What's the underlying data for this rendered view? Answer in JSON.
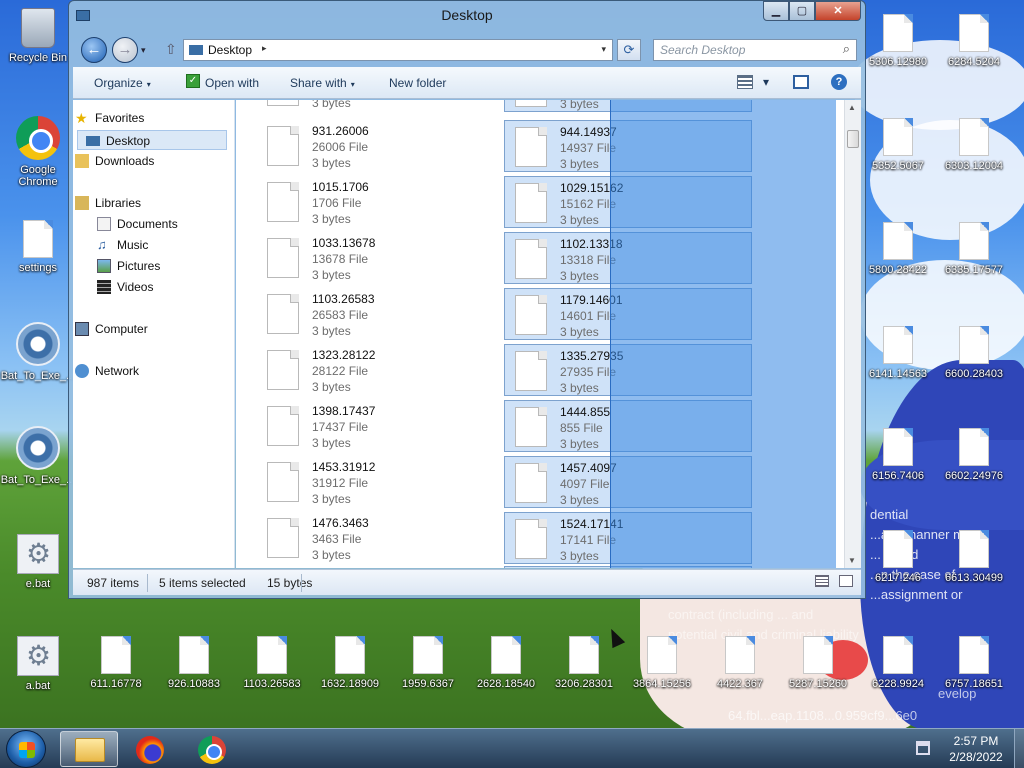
{
  "desktop": {
    "left_icons": [
      {
        "label": "Recycle Bin"
      },
      {
        "label": "Google Chrome"
      },
      {
        "label": "settings"
      },
      {
        "label": "Bat_To_Exe_..."
      },
      {
        "label": "Bat_To_Exe_..."
      },
      {
        "label": "e.bat"
      },
      {
        "label": "a.bat"
      }
    ],
    "right_icons_col1": [
      "5306.12980",
      "5352.5067",
      "5800.28422",
      "6141.14563",
      "6156.7406",
      "6217.246",
      "6228.9924"
    ],
    "right_icons_col2": [
      "6284.5204",
      "6303.12004",
      "6335.17577",
      "6600.28403",
      "6602.24976",
      "6613.30499",
      "6757.18651"
    ],
    "bottom_icons": [
      "611.16778",
      "926.10883",
      "1103.26583",
      "1632.18909",
      "1959.6367",
      "2628.18540",
      "3206.28301",
      "3864.15256",
      "4422.367",
      "5287.15260"
    ],
    "wallpaper_text_1": "dential\n...any manner may\n... includ\n...n the case of\n...assignment or",
    "wallpaper_text_2": "contract (including ... and\npotential civil and criminal liability",
    "wallpaper_text_3": "evelop",
    "wallpaper_text_4": "64.fbl...eap.1108...0.959cf9...6e0"
  },
  "window": {
    "title": "Desktop",
    "min_glyph": "▁",
    "max_glyph": "▢",
    "close_glyph": "✕",
    "back_glyph": "←",
    "fwd_glyph": "→",
    "dropdown_glyph": "▾",
    "up_glyph": "⇧",
    "address": "Desktop",
    "address_sep": "▸",
    "refresh_glyph": "⟳",
    "search_placeholder": "Search Desktop",
    "search_glyph": "⌕",
    "toolbar": {
      "organize": "Organize",
      "open_with": "Open with",
      "share_with": "Share with",
      "new_folder": "New folder",
      "caret": "▾",
      "help": "?"
    },
    "nav": {
      "favorites": "Favorites",
      "desktop": "Desktop",
      "downloads": "Downloads",
      "libraries": "Libraries",
      "documents": "Documents",
      "music": "Music",
      "pictures": "Pictures",
      "videos": "Videos",
      "computer": "Computer",
      "network": "Network"
    },
    "files_left": [
      {
        "name": "931.26006",
        "type": "26006 File",
        "size": "3 bytes"
      },
      {
        "name": "1015.1706",
        "type": "1706 File",
        "size": "3 bytes"
      },
      {
        "name": "1033.13678",
        "type": "13678 File",
        "size": "3 bytes"
      },
      {
        "name": "1103.26583",
        "type": "26583 File",
        "size": "3 bytes"
      },
      {
        "name": "1323.28122",
        "type": "28122 File",
        "size": "3 bytes"
      },
      {
        "name": "1398.17437",
        "type": "17437 File",
        "size": "3 bytes"
      },
      {
        "name": "1453.31912",
        "type": "31912 File",
        "size": "3 bytes"
      },
      {
        "name": "1476.3463",
        "type": "3463 File",
        "size": "3 bytes"
      }
    ],
    "files_right": [
      {
        "name": "944.14937",
        "type": "14937 File",
        "size": "3 bytes"
      },
      {
        "name": "1029.15162",
        "type": "15162 File",
        "size": "3 bytes"
      },
      {
        "name": "1102.13318",
        "type": "13318 File",
        "size": "3 bytes"
      },
      {
        "name": "1179.14601",
        "type": "14601 File",
        "size": "3 bytes"
      },
      {
        "name": "1335.27935",
        "type": "27935 File",
        "size": "3 bytes"
      },
      {
        "name": "1444.855",
        "type": "855 File",
        "size": "3 bytes"
      },
      {
        "name": "1457.4097",
        "type": "4097 File",
        "size": "3 bytes"
      },
      {
        "name": "1524.17141",
        "type": "17141 File",
        "size": "3 bytes"
      }
    ],
    "partial_top_size": "3 bytes",
    "scroll_up": "▲",
    "scroll_down": "▼",
    "status": {
      "items": "987 items",
      "selected": "5 items selected",
      "bytes": "15 bytes"
    }
  },
  "taskbar": {
    "time": "2:57 PM",
    "date": "2/28/2022"
  }
}
